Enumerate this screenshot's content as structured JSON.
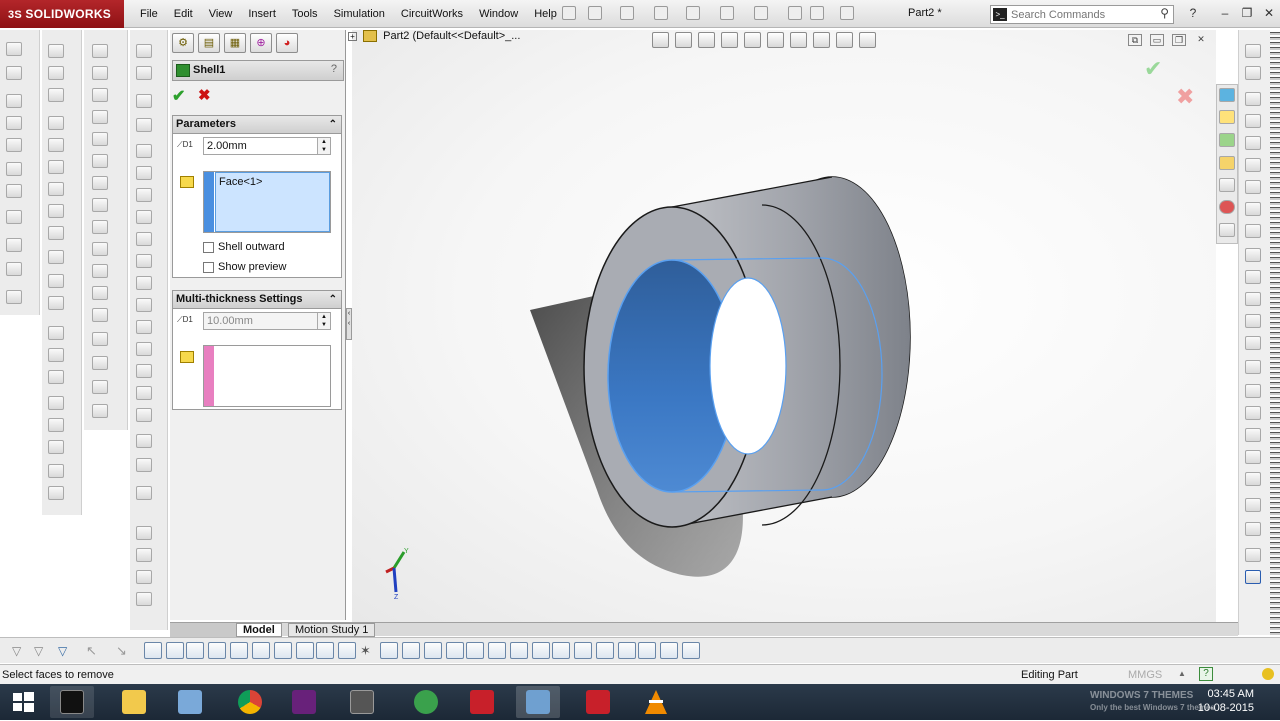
{
  "app": {
    "brand": "SOLIDWORKS",
    "document_title": "Part2 *"
  },
  "menu": [
    "File",
    "Edit",
    "View",
    "Insert",
    "Tools",
    "Simulation",
    "CircuitWorks",
    "Window",
    "Help"
  ],
  "search": {
    "placeholder": "Search Commands"
  },
  "feature_tree": {
    "root_label": "Part2  (Default<<Default>_..."
  },
  "property_manager": {
    "title": "Shell1",
    "help_glyph": "?",
    "ok_glyph": "✔",
    "cancel_glyph": "✖",
    "parameters": {
      "header": "Parameters",
      "thickness": "2.00mm",
      "faces_to_remove": [
        "Face<1>"
      ],
      "shell_outward_label": "Shell outward",
      "shell_outward_checked": false,
      "show_preview_label": "Show preview",
      "show_preview_checked": false
    },
    "multi_thickness": {
      "header": "Multi-thickness Settings",
      "thickness": "10.00mm"
    }
  },
  "tabs": {
    "model": "Model",
    "motion_study": "Motion Study 1"
  },
  "status": {
    "message": "Select faces to remove",
    "mode": "Editing Part",
    "units": "MMGS",
    "help_glyph": "?"
  },
  "taskbar": {
    "time": "03:45 AM",
    "date": "10-08-2015",
    "watermark_line1": "WINDOWS 7 THEMES",
    "watermark_line2": "Only the best Windows 7 themes",
    "apps": [
      "cmd",
      "file-explorer",
      "remote-desktop",
      "chrome",
      "visual-studio",
      "calculator",
      "solidworks-3dexperience",
      "solidworks",
      "solidworks-active",
      "solidworks-2",
      "vlc"
    ]
  },
  "colors": {
    "brand_red": "#a11d21",
    "selection_blue": "#3d7fd1",
    "model_gray": "#9a9ea6",
    "ok_green": "#2ca02c",
    "cancel_red": "#cc1111",
    "selection_box_fill": "#cce4ff",
    "selection_box_strip": "#4a8fe0",
    "multithickness_strip": "#e87fc0"
  }
}
